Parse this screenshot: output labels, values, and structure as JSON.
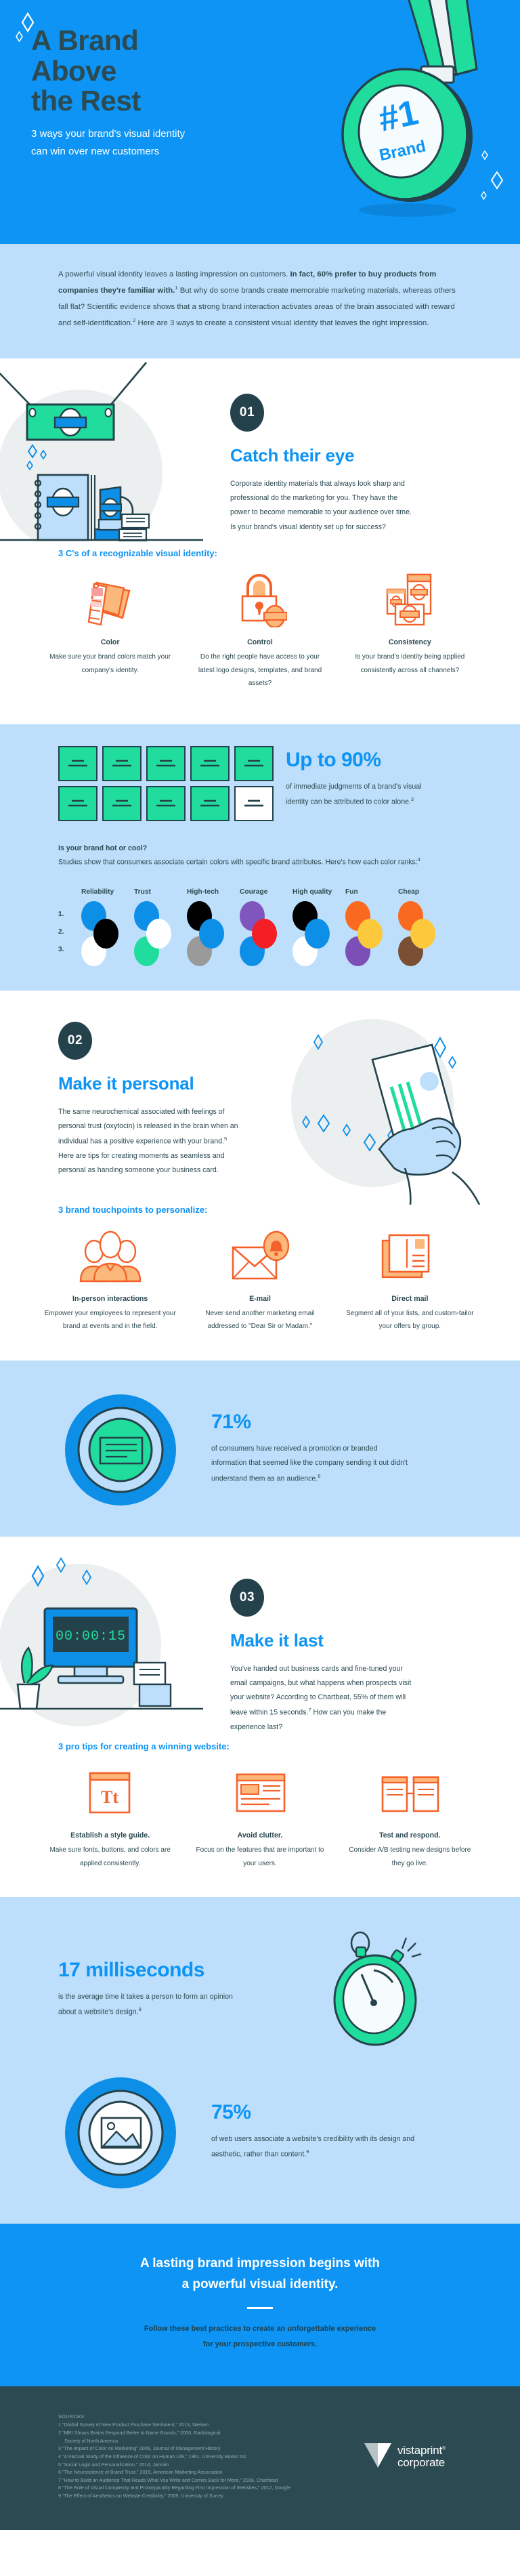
{
  "colors": {
    "brand_blue": "#0d94f4",
    "pale_blue": "#bedffb",
    "dark_teal": "#2c4a52",
    "green": "#21dd9d",
    "orange": "#f4622c",
    "light_orange": "#fbb87a"
  },
  "hero": {
    "title_line1": "A Brand",
    "title_line2": "Above",
    "title_line3": "the Rest",
    "subtitle": "3 ways your brand's visual identity can win over new customers",
    "medal_number": "#1",
    "medal_label": "Brand"
  },
  "intro": {
    "part1": "A powerful visual identity leaves a lasting impression on customers. ",
    "bold": "In fact, 60% prefer to buy products from companies they're familiar with.",
    "sup1": "1",
    "part2": " But why do some brands create memorable marketing materials, whereas others fall flat? Scientific evidence shows that a strong brand interaction activates areas of the brain associated with reward and self-identification.",
    "sup2": "2",
    "part3": " Here are 3 ways to create a consistent visual identity that leaves the right impression."
  },
  "section01": {
    "badge": "01",
    "heading": "Catch their eye",
    "body": "Corporate identity materials that always look sharp and professional do the marketing for you. They have the power to become memorable to your audience over time. Is your brand's visual identity set up for success?",
    "sub_heading": "3 C's of a recognizable visual identity:",
    "cards": [
      {
        "icon": "color-swatches-icon",
        "title": "Color",
        "desc": "Make sure your brand colors match your company's identity."
      },
      {
        "icon": "padlock-icon",
        "title": "Control",
        "desc": "Do the right people have access to your latest logo designs, templates, and brand assets?"
      },
      {
        "icon": "brand-documents-icon",
        "title": "Consistency",
        "desc": "Is your brand's identity being applied consistently across all channels?"
      }
    ]
  },
  "stat90": {
    "value": "Up to 90%",
    "desc_part1": "of immediate judgments of a brand's visual identity can be attributed to color alone.",
    "sup": "3",
    "cards_total": 10,
    "cards_highlighted": 1,
    "hot_cool_title": "Is your brand hot or cool?",
    "hot_cool_desc_part1": "Studies show that consumers associate certain colors with specific brand attributes. Here's how each color ranks:",
    "hot_cool_sup": "4",
    "rank_labels": [
      "1.",
      "2.",
      "3."
    ]
  },
  "chart_data": {
    "type": "table",
    "title": "Color rankings by brand attribute",
    "categories": [
      "Reliability",
      "Trust",
      "High-tech",
      "Courage",
      "High quality",
      "Fun",
      "Cheap"
    ],
    "rank_labels": [
      "1.",
      "2.",
      "3."
    ],
    "series": [
      {
        "name": "Reliability",
        "values": [
          "#0d8fe8",
          "#000000",
          "#ffffff"
        ]
      },
      {
        "name": "Trust",
        "values": [
          "#0d8fe8",
          "#ffffff",
          "#21dd9d"
        ]
      },
      {
        "name": "High-tech",
        "values": [
          "#000000",
          "#0d8fe8",
          "#9a9a9a"
        ]
      },
      {
        "name": "Courage",
        "values": [
          "#8055bd",
          "#f41f24",
          "#0d8fe8"
        ]
      },
      {
        "name": "High quality",
        "values": [
          "#000000",
          "#0d8fe8",
          "#ffffff"
        ]
      },
      {
        "name": "Fun",
        "values": [
          "#f96a20",
          "#fcc93c",
          "#7b4fb5"
        ]
      },
      {
        "name": "Cheap",
        "values": [
          "#f96a20",
          "#fcc93c",
          "#7a4f34"
        ]
      }
    ]
  },
  "section02": {
    "badge": "02",
    "heading": "Make it personal",
    "body_part1": "The same neurochemical associated with feelings of personal trust (oxytocin) is released in the brain when an individual has a positive experience with your brand.",
    "sup": "5",
    "body_part2": " Here are tips for creating moments as seamless and personal as handing someone your business card.",
    "sub_heading": "3 brand touchpoints to personalize:",
    "cards": [
      {
        "icon": "people-group-icon",
        "title": "In-person interactions",
        "desc": "Empower your employees to represent your brand at events and in the field."
      },
      {
        "icon": "email-notification-icon",
        "title": "E-mail",
        "desc": "Never send another marketing email addressed to \"Dear Sir or Madam.\""
      },
      {
        "icon": "direct-mail-icon",
        "title": "Direct mail",
        "desc": "Segment all of your lists, and custom-tailor your offers by group."
      }
    ]
  },
  "stat71": {
    "value": "71%",
    "desc_part1": "of consumers have received a promotion or branded information that seemed like the company sending it out didn't understand them as an audience.",
    "sup": "6"
  },
  "section03": {
    "badge": "03",
    "heading": "Make it last",
    "body_part1": "You've handed out business cards and fine-tuned your email campaigns, but what happens when prospects visit your website? According to Chartbeat, 55% of them will leave within 15 seconds.",
    "sup": "7",
    "body_part2": " How can you make the experience last?",
    "sub_heading": "3 pro tips for creating a winning website:",
    "timer_display": "00:00:15",
    "cards": [
      {
        "icon": "typography-icon",
        "title": "Establish a style guide.",
        "desc": "Make sure fonts, buttons, and colors are applied consistently."
      },
      {
        "icon": "layout-clutter-icon",
        "title": "Avoid clutter.",
        "desc": "Focus on the features that are important to your users."
      },
      {
        "icon": "ab-test-icon",
        "title": "Test and respond.",
        "desc": "Consider A/B testing new designs before they go live."
      }
    ]
  },
  "stat17": {
    "value": "17 milliseconds",
    "desc_part1": "is the average time it takes a person to form an opinion about a website's design.",
    "sup": "8"
  },
  "stat75": {
    "value": "75%",
    "desc_part1": "of web users associate a website's credibility with its design and aesthetic, rather than content.",
    "sup": "9"
  },
  "cta": {
    "heading_line1": "A lasting brand impression begins with",
    "heading_line2": "a powerful visual identity.",
    "body_line1": "Follow these best practices to create an unforgettable experience",
    "body_line2": "for your prospective customers."
  },
  "footer": {
    "sources_label": "SOURCES:",
    "sources": [
      "1 \"Global Survey of New Product Purchase Sentiment,\" 2013, Nielsen",
      "2 \"MRI Shows Brains Respond Better to Name Brands,\" 2006, Radiological",
      "Society of North America",
      "3 \"The Impact of Color on Marketing\" 2006, Journal of Management History",
      "4 \"A Factual Study of the Influence of Color on Human Life,\" 1961, University Books Inc.",
      "5 \"Social Login and Personalization,\" 2014, Janrain",
      "6 \"The Neuroscience of Brand Trust,\" 2015, American Marketing Association",
      "7 \"How to Build an Audience That Reads What You Write and Comes Back for More,\" 2016, Chartbeat",
      "8 \"The Role of Visual Complexity and Prototypicality Regarding First Impression of Websites,\" 2012, Google",
      "9 \"The Effect of Aesthetics on Website Credibility,\" 2009, University of Surrey"
    ],
    "logo_line1": "vistaprint",
    "logo_line2": "corporate",
    "logo_trademark": "®"
  }
}
